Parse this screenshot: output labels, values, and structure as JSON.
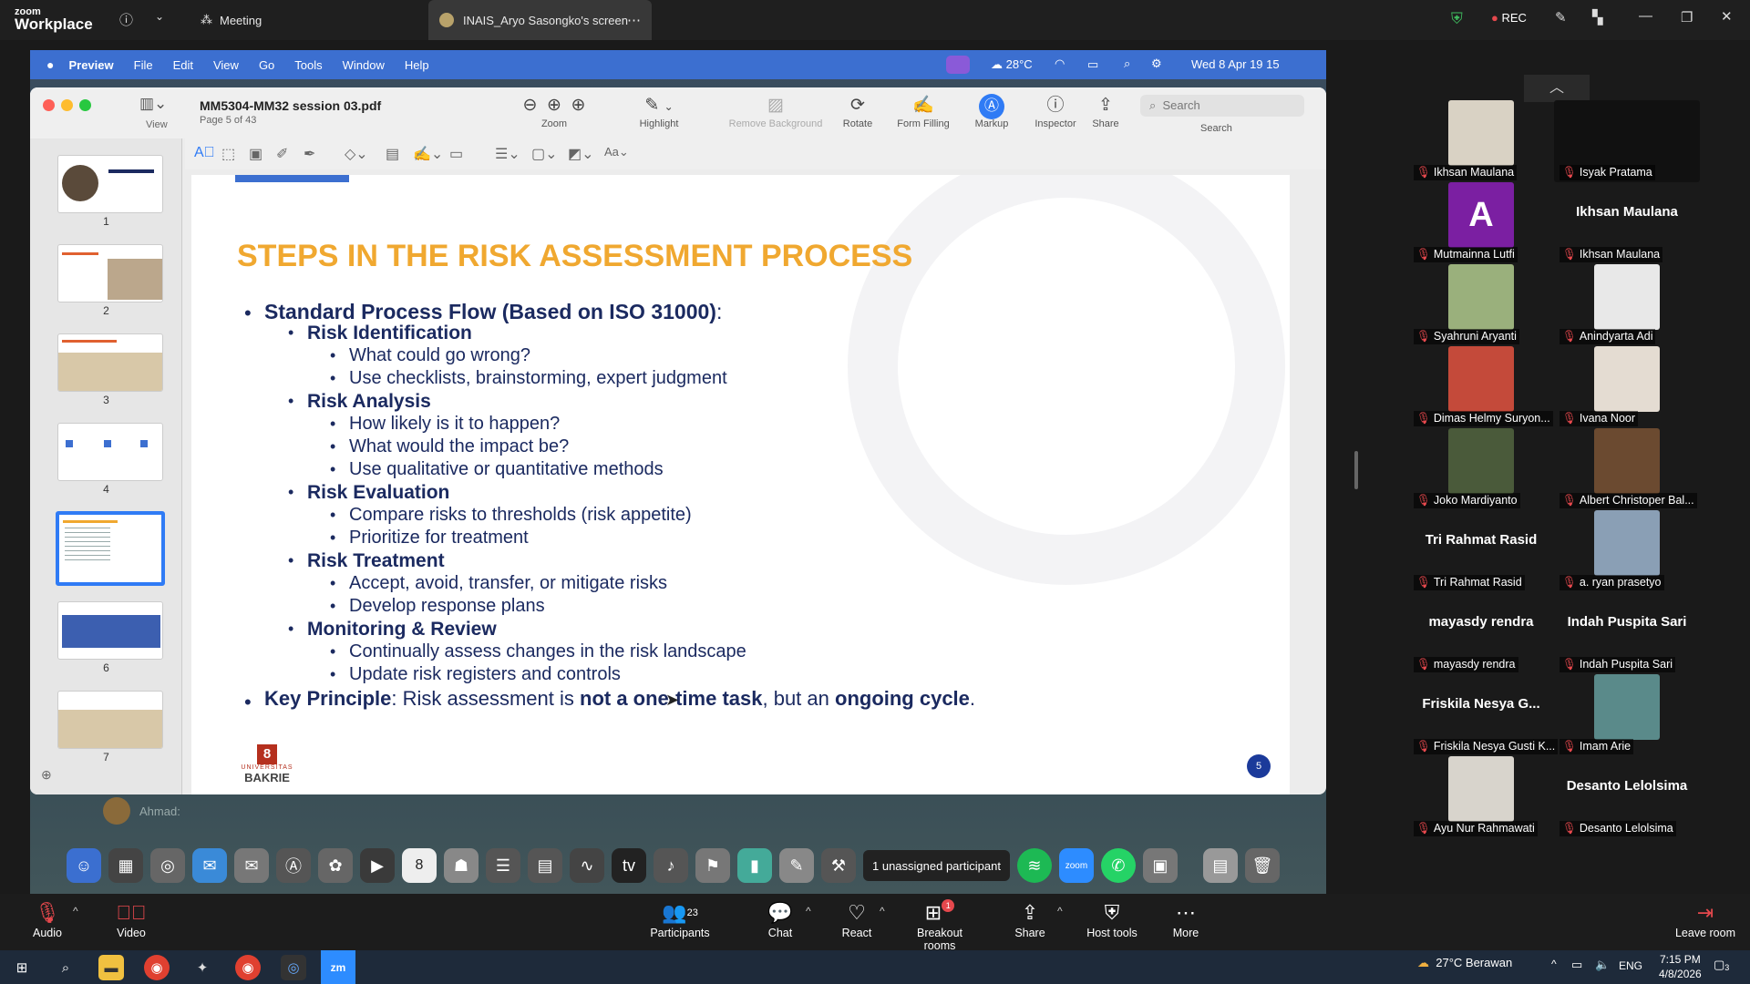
{
  "zoom_top": {
    "logo_small": "zoom",
    "logo_big": "Workplace",
    "meeting_tab": "Meeting",
    "screen_tab": "INAIS_Aryo Sasongko's screen",
    "rec_label": "REC"
  },
  "mac_menubar": {
    "app": "Preview",
    "items": [
      "File",
      "Edit",
      "View",
      "Go",
      "Tools",
      "Window",
      "Help"
    ],
    "weather": "28°C",
    "datetime": "Wed 8 Apr  19 15"
  },
  "preview": {
    "filename": "MM5304-MM32 session 03.pdf",
    "page_info": "Page 5 of 43",
    "view_label": "View",
    "toolbar": {
      "zoom": "Zoom",
      "highlight": "Highlight",
      "remove_background": "Remove Background",
      "rotate": "Rotate",
      "form_filling": "Form Filling",
      "markup": "Markup",
      "inspector": "Inspector",
      "share": "Share",
      "search_placeholder": "Search",
      "search_label": "Search"
    },
    "markup_font": "Aa",
    "thumbnails": [
      "1",
      "2",
      "3",
      "4",
      "5",
      "6",
      "7"
    ],
    "selected_page": 5
  },
  "slide": {
    "title": "STEPS IN THE RISK ASSESSMENT PROCESS",
    "heading1": "Standard Process Flow (Based on ISO 31000)",
    "heading1_colon": ":",
    "sections": [
      {
        "name": "Risk Identification",
        "items": [
          "What could go wrong?",
          "Use checklists, brainstorming, expert judgment"
        ]
      },
      {
        "name": "Risk Analysis",
        "items": [
          "How likely is it to happen?",
          "What would the impact be?",
          "Use qualitative or quantitative methods"
        ]
      },
      {
        "name": "Risk Evaluation",
        "items": [
          "Compare risks to thresholds (risk appetite)",
          "Prioritize for treatment"
        ]
      },
      {
        "name": "Risk Treatment",
        "items": [
          "Accept, avoid, transfer, or mitigate risks",
          "Develop response plans"
        ]
      },
      {
        "name": "Monitoring & Review",
        "items": [
          "Continually assess changes in the risk landscape",
          "Update risk registers and controls"
        ]
      }
    ],
    "key_principle": {
      "label": "Key Principle",
      "text1": ": Risk assessment is ",
      "bold1": "not a one-time task",
      "text2": ", but an ",
      "bold2": "ongoing cycle",
      "text3": "."
    },
    "logo_text1": "UNIVERSITAS",
    "logo_text2": "BAKRIE",
    "page_badge": "5"
  },
  "chat_strip": {
    "name": "Ahmad:"
  },
  "dock": {
    "calendar_day": "8",
    "unassigned": "1 unassigned participant"
  },
  "participants": [
    {
      "label": "Ikhsan Maulana",
      "type": "photo",
      "color": "#d9d2c4"
    },
    {
      "label": "Isyak Pratama",
      "type": "dark",
      "color": "#111111"
    },
    {
      "label": "Mutmainna Lutfi",
      "type": "avatar",
      "color": "#7b1fa2",
      "initial": "A"
    },
    {
      "label": "Ikhsan Maulana",
      "type": "name",
      "big": "Ikhsan Maulana"
    },
    {
      "label": "Syahruni Aryanti",
      "type": "photo",
      "color": "#9ab07c"
    },
    {
      "label": "Anindyarta Adi",
      "type": "photo",
      "color": "#e8e8e8"
    },
    {
      "label": "Dimas Helmy Suryon...",
      "type": "photo",
      "color": "#c44a3a"
    },
    {
      "label": "Ivana Noor",
      "type": "photo",
      "color": "#e4dcd2"
    },
    {
      "label": "Joko Mardiyanto",
      "type": "photo",
      "color": "#4a5a3a"
    },
    {
      "label": "Albert Christoper Bal...",
      "type": "photo",
      "color": "#6b4a30"
    },
    {
      "label": "Tri Rahmat Rasid",
      "type": "name",
      "big": "Tri Rahmat Rasid"
    },
    {
      "label": "a. ryan prasetyo",
      "type": "photo",
      "color": "#8a9fb5"
    },
    {
      "label": "mayasdy rendra",
      "type": "name",
      "big": "mayasdy rendra"
    },
    {
      "label": "Indah Puspita Sari",
      "type": "name",
      "big": "Indah Puspita Sari"
    },
    {
      "label": "Friskila Nesya Gusti K...",
      "type": "name",
      "big": "Friskila Nesya G..."
    },
    {
      "label": "Imam Arie",
      "type": "photo",
      "color": "#5a8a8a"
    },
    {
      "label": "Ayu Nur Rahmawati",
      "type": "photo",
      "color": "#d8d4cc"
    },
    {
      "label": "Desanto Lelolsima",
      "type": "name",
      "big": "Desanto Lelolsima"
    }
  ],
  "zoom_bottom": {
    "audio": "Audio",
    "video": "Video",
    "participants": "Participants",
    "participants_count": "23",
    "chat": "Chat",
    "react": "React",
    "breakout": "Breakout rooms",
    "breakout_badge": "1",
    "share": "Share",
    "host_tools": "Host tools",
    "more": "More",
    "leave": "Leave room"
  },
  "taskbar": {
    "weather": "27°C  Berawan",
    "lang": "ENG",
    "time": "7:15 PM",
    "date": "4/8/2026",
    "notif": "3"
  },
  "colors": {
    "title_orange": "#f0a830",
    "navy": "#1b2a60",
    "mac_menu": "#3c6fd0",
    "markup_active": "#2f7bf5",
    "mic_off": "#e5484d"
  }
}
